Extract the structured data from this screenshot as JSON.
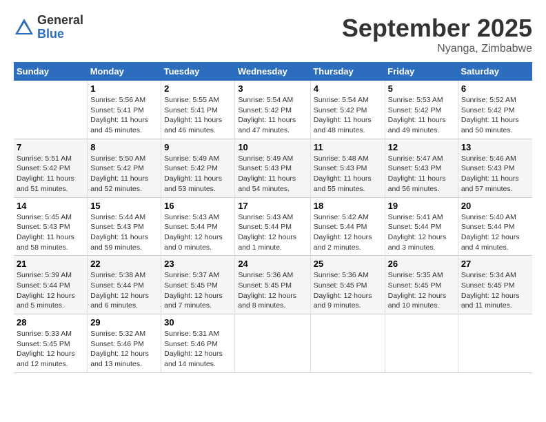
{
  "header": {
    "logo": {
      "general": "General",
      "blue": "Blue"
    },
    "title": "September 2025",
    "subtitle": "Nyanga, Zimbabwe"
  },
  "calendar": {
    "days_of_week": [
      "Sunday",
      "Monday",
      "Tuesday",
      "Wednesday",
      "Thursday",
      "Friday",
      "Saturday"
    ],
    "weeks": [
      [
        {
          "day": "",
          "sunrise": "",
          "sunset": "",
          "daylight": ""
        },
        {
          "day": "1",
          "sunrise": "Sunrise: 5:56 AM",
          "sunset": "Sunset: 5:41 PM",
          "daylight": "Daylight: 11 hours and 45 minutes."
        },
        {
          "day": "2",
          "sunrise": "Sunrise: 5:55 AM",
          "sunset": "Sunset: 5:41 PM",
          "daylight": "Daylight: 11 hours and 46 minutes."
        },
        {
          "day": "3",
          "sunrise": "Sunrise: 5:54 AM",
          "sunset": "Sunset: 5:42 PM",
          "daylight": "Daylight: 11 hours and 47 minutes."
        },
        {
          "day": "4",
          "sunrise": "Sunrise: 5:54 AM",
          "sunset": "Sunset: 5:42 PM",
          "daylight": "Daylight: 11 hours and 48 minutes."
        },
        {
          "day": "5",
          "sunrise": "Sunrise: 5:53 AM",
          "sunset": "Sunset: 5:42 PM",
          "daylight": "Daylight: 11 hours and 49 minutes."
        },
        {
          "day": "6",
          "sunrise": "Sunrise: 5:52 AM",
          "sunset": "Sunset: 5:42 PM",
          "daylight": "Daylight: 11 hours and 50 minutes."
        }
      ],
      [
        {
          "day": "7",
          "sunrise": "Sunrise: 5:51 AM",
          "sunset": "Sunset: 5:42 PM",
          "daylight": "Daylight: 11 hours and 51 minutes."
        },
        {
          "day": "8",
          "sunrise": "Sunrise: 5:50 AM",
          "sunset": "Sunset: 5:42 PM",
          "daylight": "Daylight: 11 hours and 52 minutes."
        },
        {
          "day": "9",
          "sunrise": "Sunrise: 5:49 AM",
          "sunset": "Sunset: 5:42 PM",
          "daylight": "Daylight: 11 hours and 53 minutes."
        },
        {
          "day": "10",
          "sunrise": "Sunrise: 5:49 AM",
          "sunset": "Sunset: 5:43 PM",
          "daylight": "Daylight: 11 hours and 54 minutes."
        },
        {
          "day": "11",
          "sunrise": "Sunrise: 5:48 AM",
          "sunset": "Sunset: 5:43 PM",
          "daylight": "Daylight: 11 hours and 55 minutes."
        },
        {
          "day": "12",
          "sunrise": "Sunrise: 5:47 AM",
          "sunset": "Sunset: 5:43 PM",
          "daylight": "Daylight: 11 hours and 56 minutes."
        },
        {
          "day": "13",
          "sunrise": "Sunrise: 5:46 AM",
          "sunset": "Sunset: 5:43 PM",
          "daylight": "Daylight: 11 hours and 57 minutes."
        }
      ],
      [
        {
          "day": "14",
          "sunrise": "Sunrise: 5:45 AM",
          "sunset": "Sunset: 5:43 PM",
          "daylight": "Daylight: 11 hours and 58 minutes."
        },
        {
          "day": "15",
          "sunrise": "Sunrise: 5:44 AM",
          "sunset": "Sunset: 5:43 PM",
          "daylight": "Daylight: 11 hours and 59 minutes."
        },
        {
          "day": "16",
          "sunrise": "Sunrise: 5:43 AM",
          "sunset": "Sunset: 5:44 PM",
          "daylight": "Daylight: 12 hours and 0 minutes."
        },
        {
          "day": "17",
          "sunrise": "Sunrise: 5:43 AM",
          "sunset": "Sunset: 5:44 PM",
          "daylight": "Daylight: 12 hours and 1 minute."
        },
        {
          "day": "18",
          "sunrise": "Sunrise: 5:42 AM",
          "sunset": "Sunset: 5:44 PM",
          "daylight": "Daylight: 12 hours and 2 minutes."
        },
        {
          "day": "19",
          "sunrise": "Sunrise: 5:41 AM",
          "sunset": "Sunset: 5:44 PM",
          "daylight": "Daylight: 12 hours and 3 minutes."
        },
        {
          "day": "20",
          "sunrise": "Sunrise: 5:40 AM",
          "sunset": "Sunset: 5:44 PM",
          "daylight": "Daylight: 12 hours and 4 minutes."
        }
      ],
      [
        {
          "day": "21",
          "sunrise": "Sunrise: 5:39 AM",
          "sunset": "Sunset: 5:44 PM",
          "daylight": "Daylight: 12 hours and 5 minutes."
        },
        {
          "day": "22",
          "sunrise": "Sunrise: 5:38 AM",
          "sunset": "Sunset: 5:44 PM",
          "daylight": "Daylight: 12 hours and 6 minutes."
        },
        {
          "day": "23",
          "sunrise": "Sunrise: 5:37 AM",
          "sunset": "Sunset: 5:45 PM",
          "daylight": "Daylight: 12 hours and 7 minutes."
        },
        {
          "day": "24",
          "sunrise": "Sunrise: 5:36 AM",
          "sunset": "Sunset: 5:45 PM",
          "daylight": "Daylight: 12 hours and 8 minutes."
        },
        {
          "day": "25",
          "sunrise": "Sunrise: 5:36 AM",
          "sunset": "Sunset: 5:45 PM",
          "daylight": "Daylight: 12 hours and 9 minutes."
        },
        {
          "day": "26",
          "sunrise": "Sunrise: 5:35 AM",
          "sunset": "Sunset: 5:45 PM",
          "daylight": "Daylight: 12 hours and 10 minutes."
        },
        {
          "day": "27",
          "sunrise": "Sunrise: 5:34 AM",
          "sunset": "Sunset: 5:45 PM",
          "daylight": "Daylight: 12 hours and 11 minutes."
        }
      ],
      [
        {
          "day": "28",
          "sunrise": "Sunrise: 5:33 AM",
          "sunset": "Sunset: 5:45 PM",
          "daylight": "Daylight: 12 hours and 12 minutes."
        },
        {
          "day": "29",
          "sunrise": "Sunrise: 5:32 AM",
          "sunset": "Sunset: 5:46 PM",
          "daylight": "Daylight: 12 hours and 13 minutes."
        },
        {
          "day": "30",
          "sunrise": "Sunrise: 5:31 AM",
          "sunset": "Sunset: 5:46 PM",
          "daylight": "Daylight: 12 hours and 14 minutes."
        },
        {
          "day": "",
          "sunrise": "",
          "sunset": "",
          "daylight": ""
        },
        {
          "day": "",
          "sunrise": "",
          "sunset": "",
          "daylight": ""
        },
        {
          "day": "",
          "sunrise": "",
          "sunset": "",
          "daylight": ""
        },
        {
          "day": "",
          "sunrise": "",
          "sunset": "",
          "daylight": ""
        }
      ]
    ]
  }
}
